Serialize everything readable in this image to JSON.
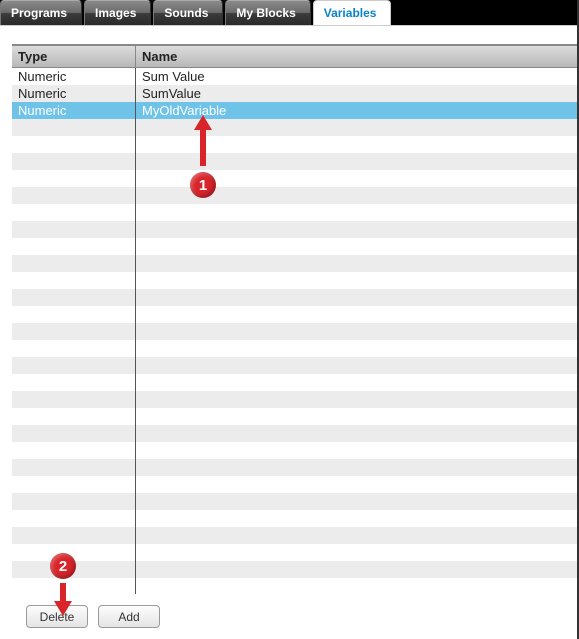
{
  "tabs": {
    "items": [
      {
        "label": "Programs",
        "active": false
      },
      {
        "label": "Images",
        "active": false
      },
      {
        "label": "Sounds",
        "active": false
      },
      {
        "label": "My Blocks",
        "active": false
      },
      {
        "label": "Variables",
        "active": true
      }
    ]
  },
  "table": {
    "headers": {
      "type": "Type",
      "name": "Name"
    },
    "rows": [
      {
        "type": "Numeric",
        "name": "Sum Value",
        "selected": false
      },
      {
        "type": "Numeric",
        "name": "SumValue",
        "selected": false
      },
      {
        "type": "Numeric",
        "name": "MyOldVariable",
        "selected": true
      }
    ]
  },
  "buttons": {
    "delete": "Delete",
    "add": "Add"
  },
  "annotations": {
    "step1": "1",
    "step2": "2"
  }
}
